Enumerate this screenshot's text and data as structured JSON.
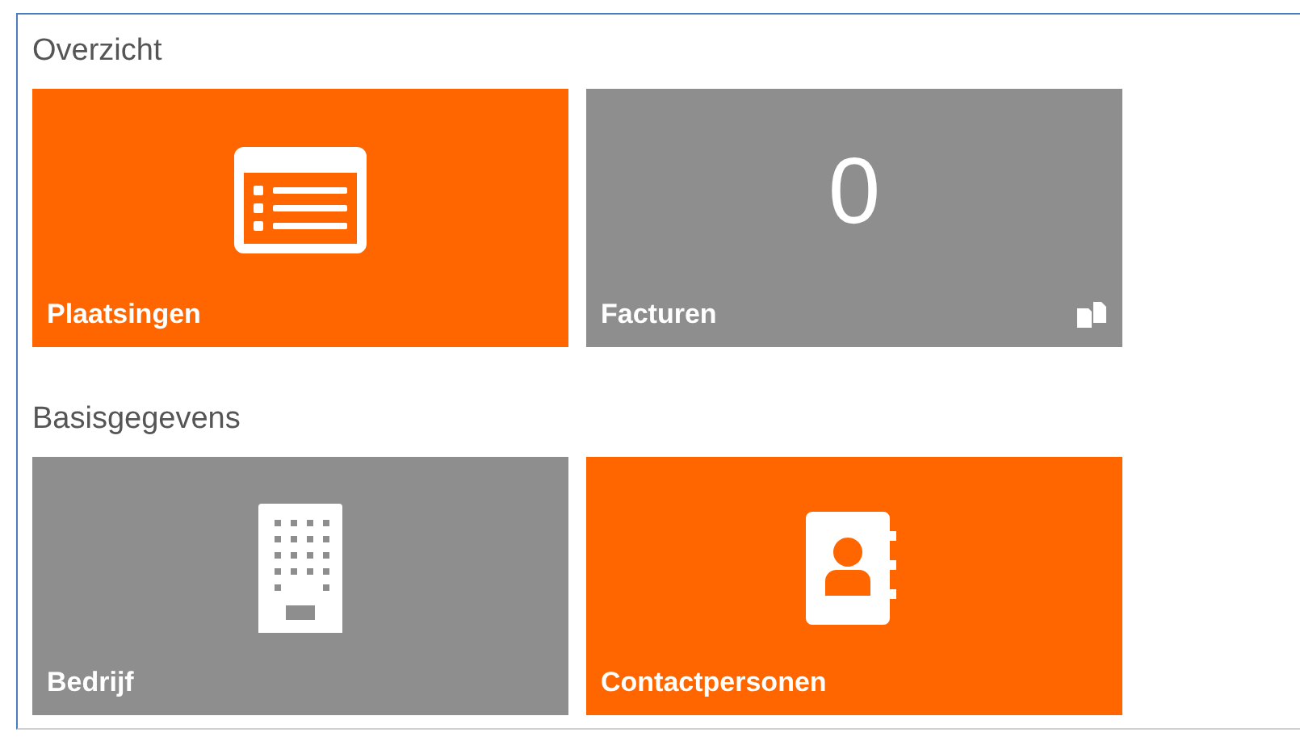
{
  "sections": [
    {
      "title": "Overzicht",
      "tiles": [
        {
          "label": "Plaatsingen",
          "color": "#ff6600",
          "kind": "list"
        },
        {
          "label": "Facturen",
          "color": "#8f8e8e",
          "kind": "count",
          "count": "0"
        }
      ]
    },
    {
      "title": "Basisgegevens",
      "tiles": [
        {
          "label": "Bedrijf",
          "color": "#8f8e8e",
          "kind": "building"
        },
        {
          "label": "Contactpersonen",
          "color": "#ff6600",
          "kind": "contacts"
        }
      ]
    }
  ]
}
